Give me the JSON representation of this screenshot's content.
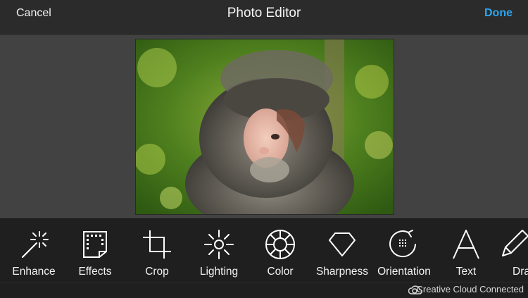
{
  "header": {
    "cancel_label": "Cancel",
    "title": "Photo Editor",
    "done_label": "Done",
    "accent_color": "#2aa6f2"
  },
  "tools": [
    {
      "label": "Enhance",
      "icon": "magic-wand-icon"
    },
    {
      "label": "Effects",
      "icon": "film-frame-icon"
    },
    {
      "label": "Crop",
      "icon": "crop-icon"
    },
    {
      "label": "Lighting",
      "icon": "sun-icon"
    },
    {
      "label": "Color",
      "icon": "color-wheel-icon"
    },
    {
      "label": "Sharpness",
      "icon": "diamond-icon"
    },
    {
      "label": "Orientation",
      "icon": "rotate-icon"
    },
    {
      "label": "Text",
      "icon": "letter-a-icon"
    },
    {
      "label": "Dra",
      "icon": "pencil-icon"
    }
  ],
  "status": {
    "creative_cloud": "Creative Cloud Connected"
  }
}
